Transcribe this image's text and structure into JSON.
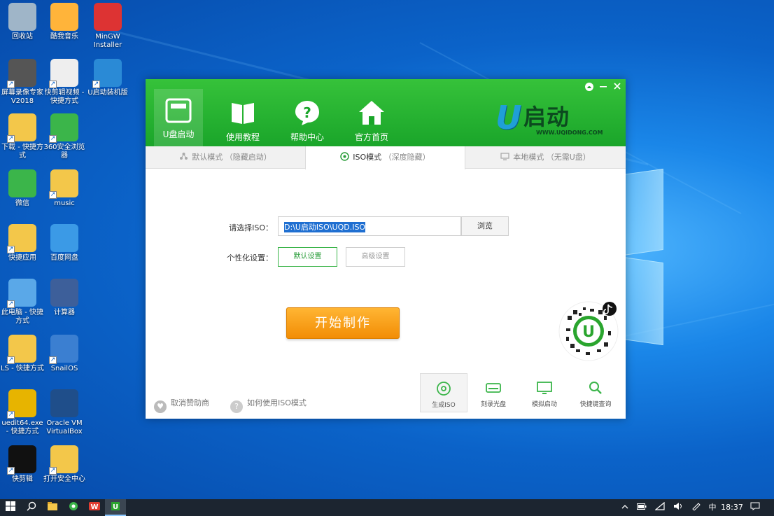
{
  "desktop": {
    "icons": [
      {
        "label": "回收站",
        "icon": "recycle-bin-icon"
      },
      {
        "label": "酷我音乐",
        "icon": "kuwo-music-icon"
      },
      {
        "label": "MinGW Installer",
        "icon": "mingw-installer-icon"
      },
      {
        "label": "屏幕录像专家V2018",
        "icon": "screen-recorder-icon"
      },
      {
        "label": "快剪辑视频 - 快捷方式",
        "icon": "video-editor-icon"
      },
      {
        "label": "U启动装机版",
        "icon": "uqidong-icon"
      },
      {
        "label": "下载 - 快捷方式",
        "icon": "download-folder-icon"
      },
      {
        "label": "360安全浏览器",
        "icon": "360-browser-icon"
      },
      {
        "label": "微信",
        "icon": "wechat-icon"
      },
      {
        "label": "music",
        "icon": "music-folder-icon"
      },
      {
        "label": "快捷应用",
        "icon": "quick-apps-folder-icon"
      },
      {
        "label": "百度网盘",
        "icon": "baidu-netdisk-icon"
      },
      {
        "label": "此电脑 - 快捷方式",
        "icon": "this-pc-icon"
      },
      {
        "label": "计算器",
        "icon": "calculator-icon"
      },
      {
        "label": "LS - 快捷方式",
        "icon": "ls-folder-icon"
      },
      {
        "label": "SnailOS",
        "icon": "snailos-icon"
      },
      {
        "label": "uedit64.exe - 快捷方式",
        "icon": "ultraedit-icon"
      },
      {
        "label": "Oracle VM VirtualBox",
        "icon": "virtualbox-icon"
      },
      {
        "label": "快剪辑",
        "icon": "kuaijianji-icon"
      },
      {
        "label": "打开安全中心",
        "icon": "security-center-icon"
      }
    ]
  },
  "app": {
    "brand": {
      "logo_letter": "U",
      "logo_text": "启动",
      "url": "WWW.UQIDONG.COM"
    },
    "nav": [
      {
        "label": "U盘启动",
        "icon": "usb-drive-icon"
      },
      {
        "label": "使用教程",
        "icon": "book-icon"
      },
      {
        "label": "帮助中心",
        "icon": "help-icon"
      },
      {
        "label": "官方首页",
        "icon": "home-icon"
      }
    ],
    "tabs": [
      {
        "label": "默认模式",
        "sub": "（隐藏启动）",
        "icon": "share-icon"
      },
      {
        "label": "ISO模式",
        "sub": "（深度隐藏）",
        "icon": "disc-icon"
      },
      {
        "label": "本地模式",
        "sub": "（无需U盘）",
        "icon": "monitor-icon"
      }
    ],
    "iso_label": "请选择ISO：",
    "iso_value": "D:\\U启动ISO\\UQD.ISO",
    "browse_label": "浏览",
    "personal_label": "个性化设置：",
    "default_settings": "默认设置",
    "advanced_settings": "高级设置",
    "start_button": "开始制作",
    "footer": {
      "cancel_sponsor": "取消赞助商",
      "how_to": "如何使用ISO模式"
    },
    "tools": [
      {
        "label": "生成ISO",
        "icon": "generate-iso-icon"
      },
      {
        "label": "刻录光盘",
        "icon": "burn-disc-icon"
      },
      {
        "label": "模拟启动",
        "icon": "simulate-boot-icon"
      },
      {
        "label": "快捷键查询",
        "icon": "search-icon"
      }
    ]
  },
  "taskbar": {
    "ime": "中",
    "time": "18:37"
  }
}
